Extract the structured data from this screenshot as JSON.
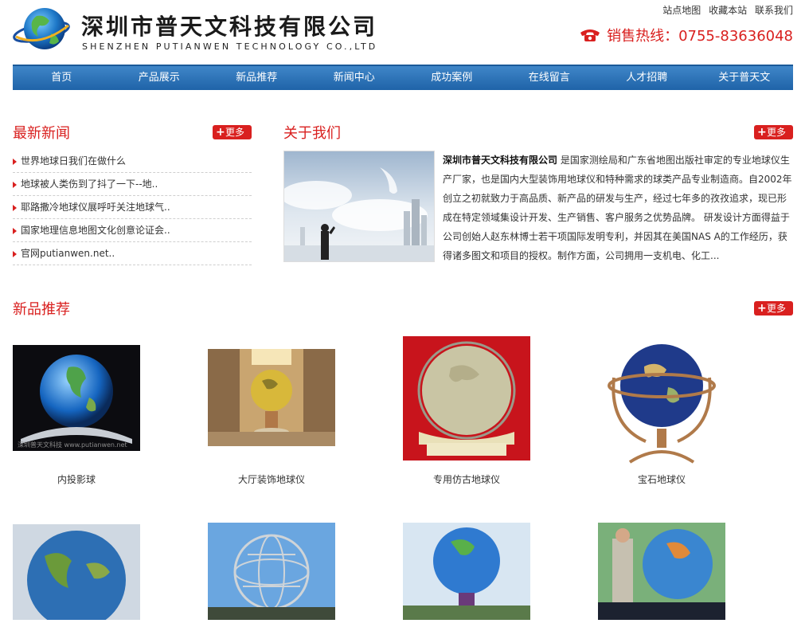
{
  "header": {
    "company_cn": "深圳市普天文科技有限公司",
    "company_en": "SHENZHEN PUTIANWEN TECHNOLOGY CO.,LTD",
    "top_links": [
      "站点地图",
      "收藏本站",
      "联系我们"
    ],
    "hotline": "销售热线：0755-83636048"
  },
  "nav": [
    "首页",
    "产品展示",
    "新品推荐",
    "新闻中心",
    "成功案例",
    "在线留言",
    "人才招聘",
    "关于普天文"
  ],
  "news": {
    "title": "最新新闻",
    "more": "更多",
    "items": [
      "世界地球日我们在做什么",
      "地球被人类伤到了抖了一下--地..",
      "耶路撒冷地球仪展呼吁关注地球气..",
      "国家地理信息地图文化创意论证会..",
      "官网putianwen.net.."
    ]
  },
  "about": {
    "title": "关于我们",
    "more": "更多",
    "company": "深圳市普天文科技有限公司",
    "text": " 是国家测绘局和广东省地图出版社审定的专业地球仪生产厂家，也是国内大型装饰用地球仪和特种需求的球类产品专业制造商。自2002年创立之初就致力于高品质、新产品的研发与生产，经过七年多的孜孜追求，现已形成在特定领域集设计开发、生产销售、客户服务之优势品牌。 研发设计方面得益于公司创始人赵东林博士若干项国际发明专利，并因其在美国NAS A的工作经历，获得诸多图文和项目的授权。制作方面，公司拥用一支机电、化工..."
  },
  "products": {
    "title": "新品推荐",
    "more": "更多",
    "watermark": "深圳普天文科技 www.putianwen.net",
    "row1": [
      "内投影球",
      "大厅装饰地球仪",
      "专用仿古地球仪",
      "宝石地球仪"
    ]
  },
  "colors": {
    "accent": "#d9201f",
    "nav": "#2a6fb3"
  }
}
